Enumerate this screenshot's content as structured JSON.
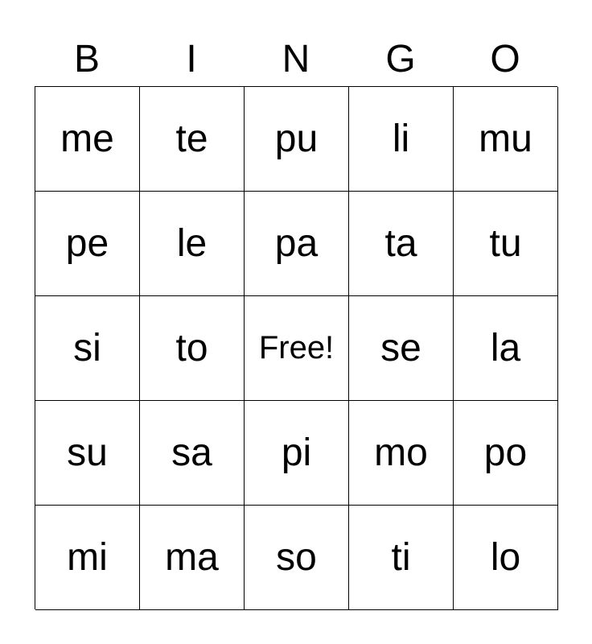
{
  "header": [
    "B",
    "I",
    "N",
    "G",
    "O"
  ],
  "rows": [
    [
      "me",
      "te",
      "pu",
      "li",
      "mu"
    ],
    [
      "pe",
      "le",
      "pa",
      "ta",
      "tu"
    ],
    [
      "si",
      "to",
      "Free!",
      "se",
      "la"
    ],
    [
      "su",
      "sa",
      "pi",
      "mo",
      "po"
    ],
    [
      "mi",
      "ma",
      "so",
      "ti",
      "lo"
    ]
  ]
}
